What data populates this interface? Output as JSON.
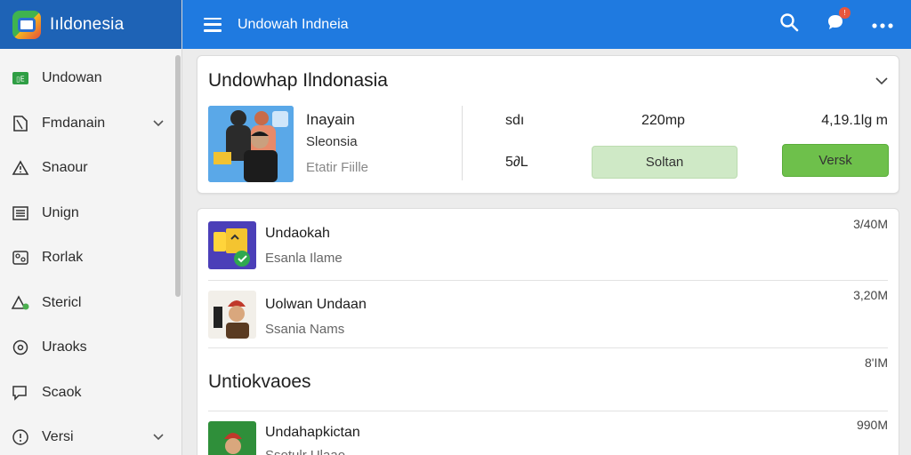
{
  "app": {
    "brand_title": "Iıldonesia",
    "header_title": "Undowah Indneia"
  },
  "sidebar": {
    "items": [
      {
        "label": "Undowan",
        "icon": "app-badge-icon",
        "chevron": false
      },
      {
        "label": "Fmdanain",
        "icon": "document-icon",
        "chevron": true
      },
      {
        "label": "Snaour",
        "icon": "warning-icon",
        "chevron": false
      },
      {
        "label": "Unign",
        "icon": "list-icon",
        "chevron": false
      },
      {
        "label": "Rorlak",
        "icon": "settings-grid-icon",
        "chevron": false
      },
      {
        "label": "Stericl",
        "icon": "alert-user-icon",
        "chevron": false
      },
      {
        "label": "Uraoks",
        "icon": "gear-icon",
        "chevron": false
      },
      {
        "label": "Scaok",
        "icon": "chat-icon",
        "chevron": false
      },
      {
        "label": "Versi",
        "icon": "info-icon",
        "chevron": true
      }
    ]
  },
  "featured": {
    "title": "Undowhap Ilndonasia",
    "name": "Inayain",
    "sub": "Sleonsia",
    "meta": "Etatir Fiille",
    "stat_label_1": "sdı",
    "stat_label_2": "5∂L",
    "stat_value_1": "220mp",
    "stat_value_2": "4,19.1lg m",
    "button_secondary": "Soltan",
    "button_primary": "Versk"
  },
  "list": {
    "rows": [
      {
        "title": "Undaokah",
        "sub": "Esanla Ilame",
        "size": "3/40M"
      },
      {
        "title": "Uolwan Undaan",
        "sub": "Ssania Nams",
        "size": "3,20M"
      }
    ],
    "section_title": "Untiokvaoes",
    "section_size": "8'IM",
    "last_row": {
      "title": "Undahapkictan",
      "sub": "Ssotulr Ulaao",
      "size": "990M"
    }
  },
  "colors": {
    "topbar": "#1f7ae0",
    "brand": "#1e63b6",
    "primary_button": "#6ec04b",
    "secondary_button": "#cfe9c6"
  }
}
